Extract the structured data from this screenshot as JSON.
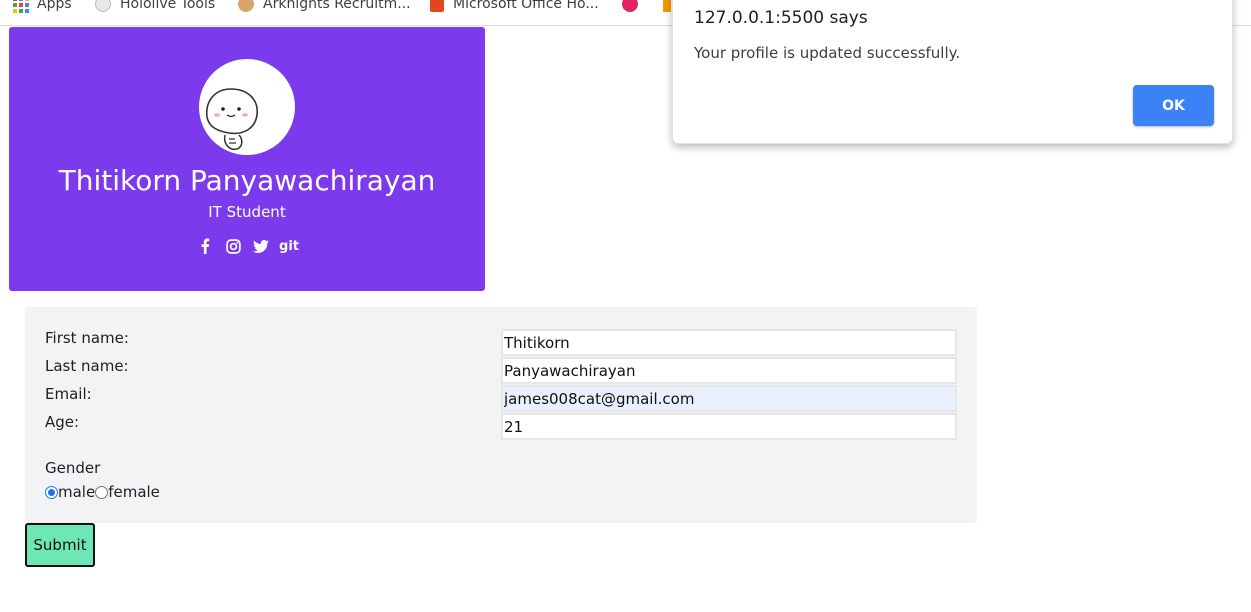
{
  "bookmarks": [
    {
      "label": "Apps",
      "icon": "apps-grid-icon"
    },
    {
      "label": "Hololive Tools",
      "icon": "hololive-favicon"
    },
    {
      "label": "Arknights Recruitm...",
      "icon": "arknights-favicon"
    },
    {
      "label": "Microsoft Office Ho...",
      "icon": "office-favicon"
    },
    {
      "label": "",
      "icon": "site-favicon-pink"
    },
    {
      "label": "",
      "icon": "site-favicon-orange"
    }
  ],
  "profile": {
    "name": "Thitikorn Panyawachirayan",
    "role": "IT Student",
    "avatar": "avatar-sticker-image",
    "socials": [
      {
        "icon": "facebook-icon"
      },
      {
        "icon": "instagram-icon"
      },
      {
        "icon": "twitter-icon"
      },
      {
        "icon": "github-icon",
        "label": "git"
      }
    ],
    "card_color": "#7c3aed"
  },
  "form": {
    "first_name_label": "First name:",
    "first_name_value": "Thitikorn",
    "last_name_label": "Last name:",
    "last_name_value": "Panyawachirayan",
    "email_label": "Email:",
    "email_value": "james008cat@gmail.com",
    "age_label": "Age:",
    "age_value": "21",
    "gender_label": "Gender",
    "gender_options": [
      "male",
      "female"
    ],
    "gender_selected": "male",
    "submit_label": "Submit",
    "submit_color": "#6ee7b7"
  },
  "dialog": {
    "title": "127.0.0.1:5500 says",
    "message": "Your profile is updated successfully.",
    "ok_label": "OK",
    "ok_color": "#3b82f6"
  }
}
